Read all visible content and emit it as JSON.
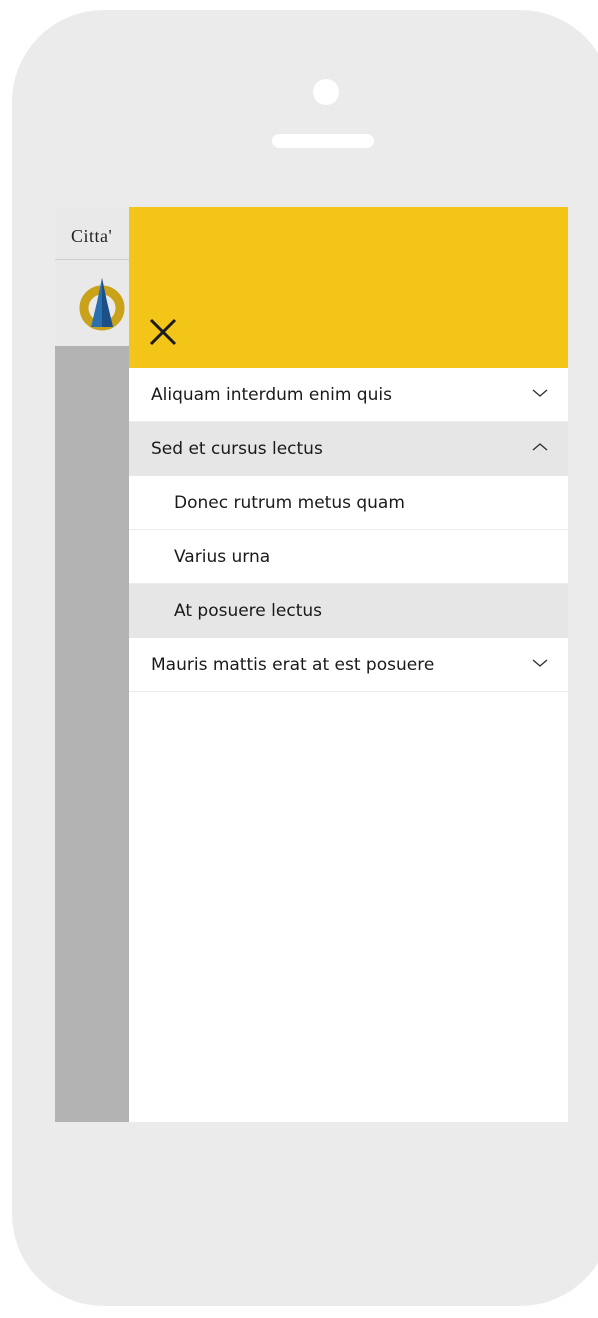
{
  "background_app": {
    "title": "Citta'",
    "logo_icon": "mole-antonelliana-logo"
  },
  "drawer": {
    "header_color": "#f2c518",
    "close_icon": "close-icon",
    "menu": [
      {
        "label": "Aliquam interdum enim quis",
        "type": "section",
        "expanded": false
      },
      {
        "label": "Sed et cursus lectus",
        "type": "section",
        "expanded": true
      },
      {
        "label": "Donec rutrum metus quam",
        "type": "subitem"
      },
      {
        "label": "Varius urna",
        "type": "subitem"
      },
      {
        "label": "At posuere lectus",
        "type": "subitem",
        "selected": true
      },
      {
        "label": "Mauris mattis erat at est posuere",
        "type": "section",
        "expanded": false
      }
    ]
  }
}
